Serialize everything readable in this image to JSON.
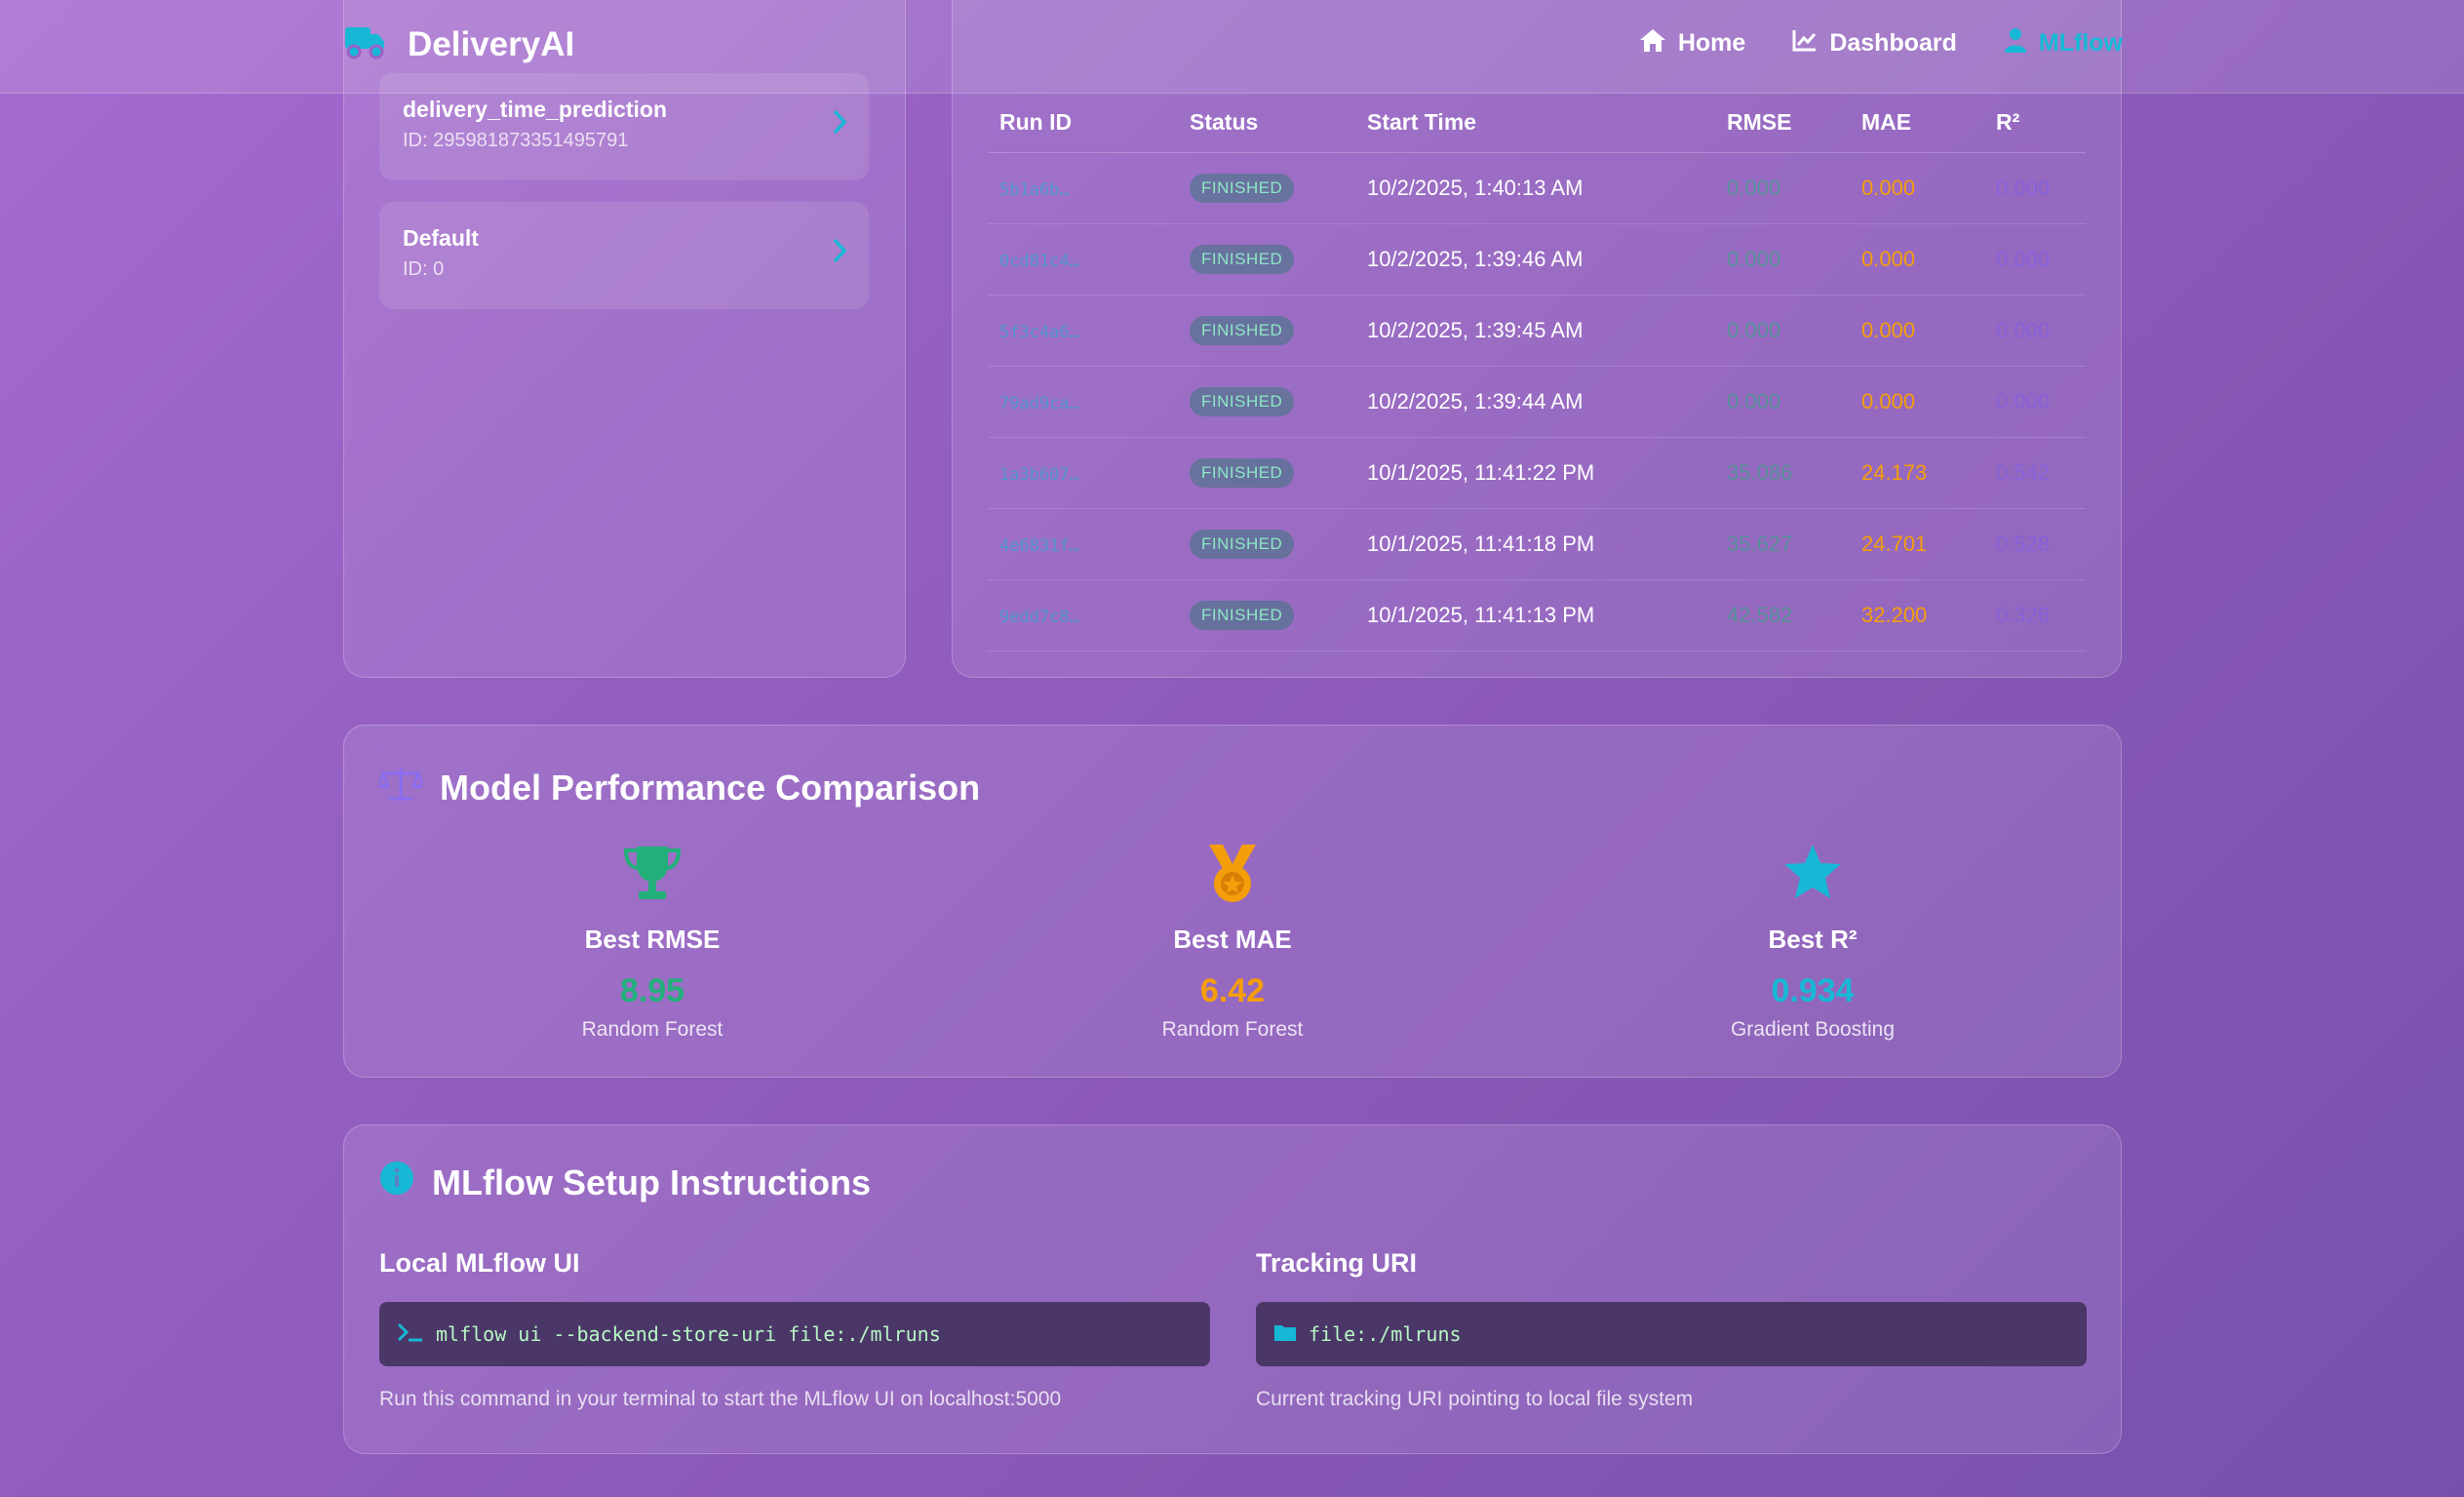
{
  "navbar": {
    "brand": "DeliveryAI",
    "items": [
      {
        "label": "Home",
        "icon": "home-icon"
      },
      {
        "label": "Dashboard",
        "icon": "chart-line-icon"
      },
      {
        "label": "MLflow",
        "icon": "user-icon",
        "active": true
      }
    ]
  },
  "experiments": [
    {
      "name": "delivery_time_prediction",
      "id": "ID: 295981873351495791"
    },
    {
      "name": "Default",
      "id": "ID: 0"
    }
  ],
  "runs": {
    "headers": [
      "Run ID",
      "Status",
      "Start Time",
      "RMSE",
      "MAE",
      "R²"
    ],
    "rows": [
      {
        "id": "5b1a6b…",
        "status": "FINISHED",
        "start": "10/2/2025, 1:40:13 AM",
        "rmse": "0.000",
        "mae": "0.000",
        "r2": "0.000"
      },
      {
        "id": "0cd81c4…",
        "status": "FINISHED",
        "start": "10/2/2025, 1:39:46 AM",
        "rmse": "0.000",
        "mae": "0.000",
        "r2": "0.000"
      },
      {
        "id": "5f3c4a6…",
        "status": "FINISHED",
        "start": "10/2/2025, 1:39:45 AM",
        "rmse": "0.000",
        "mae": "0.000",
        "r2": "0.000"
      },
      {
        "id": "79ad9ca…",
        "status": "FINISHED",
        "start": "10/2/2025, 1:39:44 AM",
        "rmse": "0.000",
        "mae": "0.000",
        "r2": "0.000"
      },
      {
        "id": "1a3b607…",
        "status": "FINISHED",
        "start": "10/1/2025, 11:41:22 PM",
        "rmse": "35.086",
        "mae": "24.173",
        "r2": "0.542"
      },
      {
        "id": "4e6831f…",
        "status": "FINISHED",
        "start": "10/1/2025, 11:41:18 PM",
        "rmse": "35.627",
        "mae": "24.701",
        "r2": "0.528"
      },
      {
        "id": "9edd7c8…",
        "status": "FINISHED",
        "start": "10/1/2025, 11:41:13 PM",
        "rmse": "42.582",
        "mae": "32.200",
        "r2": "0.326"
      }
    ]
  },
  "performance": {
    "title": "Model Performance Comparison",
    "metrics": [
      {
        "label": "Best RMSE",
        "value": "8.95",
        "model": "Random Forest",
        "icon": "trophy-icon",
        "color": "#22b07a"
      },
      {
        "label": "Best MAE",
        "value": "6.42",
        "model": "Random Forest",
        "icon": "medal-icon",
        "color": "#f59e0b"
      },
      {
        "label": "Best R²",
        "value": "0.934",
        "model": "Gradient Boosting",
        "icon": "star-icon",
        "color": "#17b8d6"
      }
    ]
  },
  "setup": {
    "title": "MLflow Setup Instructions",
    "local": {
      "heading": "Local MLflow UI",
      "command": "mlflow ui --backend-store-uri file:./mlruns",
      "note": "Run this command in your terminal to start the MLflow UI on localhost:5000"
    },
    "tracking": {
      "heading": "Tracking URI",
      "uri": "file:./mlruns",
      "note": "Current tracking URI pointing to local file system"
    }
  }
}
